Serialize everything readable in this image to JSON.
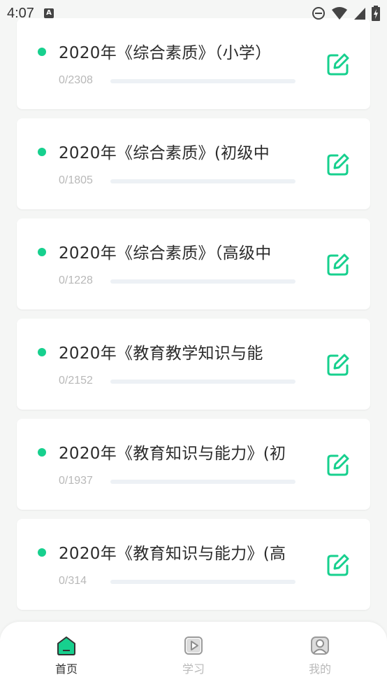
{
  "status_bar": {
    "time": "4:07",
    "notification_badge": "A"
  },
  "colors": {
    "accent": "#17d08e",
    "track": "#edf1f5",
    "muted": "#b8b8b8"
  },
  "courses": [
    {
      "title": "2020年《综合素质》（小学）",
      "done": 0,
      "total": 2308,
      "progress_text": "0/2308",
      "progress": 0
    },
    {
      "title": "2020年《综合素质》(初级中",
      "done": 0,
      "total": 1805,
      "progress_text": "0/1805",
      "progress": 0
    },
    {
      "title": "2020年《综合素质》（高级中",
      "done": 0,
      "total": 1228,
      "progress_text": "0/1228",
      "progress": 0
    },
    {
      "title": "2020年《教育教学知识与能",
      "done": 0,
      "total": 2152,
      "progress_text": "0/2152",
      "progress": 0
    },
    {
      "title": "2020年《教育知识与能力》(初",
      "done": 0,
      "total": 1937,
      "progress_text": "0/1937",
      "progress": 0
    },
    {
      "title": "2020年《教育知识与能力》(高",
      "done": 0,
      "total": 314,
      "progress_text": "0/314",
      "progress": 0
    }
  ],
  "bottom_nav": {
    "items": [
      {
        "label": "首页",
        "icon": "home-icon",
        "active": true
      },
      {
        "label": "学习",
        "icon": "play-icon",
        "active": false
      },
      {
        "label": "我的",
        "icon": "user-icon",
        "active": false
      }
    ]
  }
}
